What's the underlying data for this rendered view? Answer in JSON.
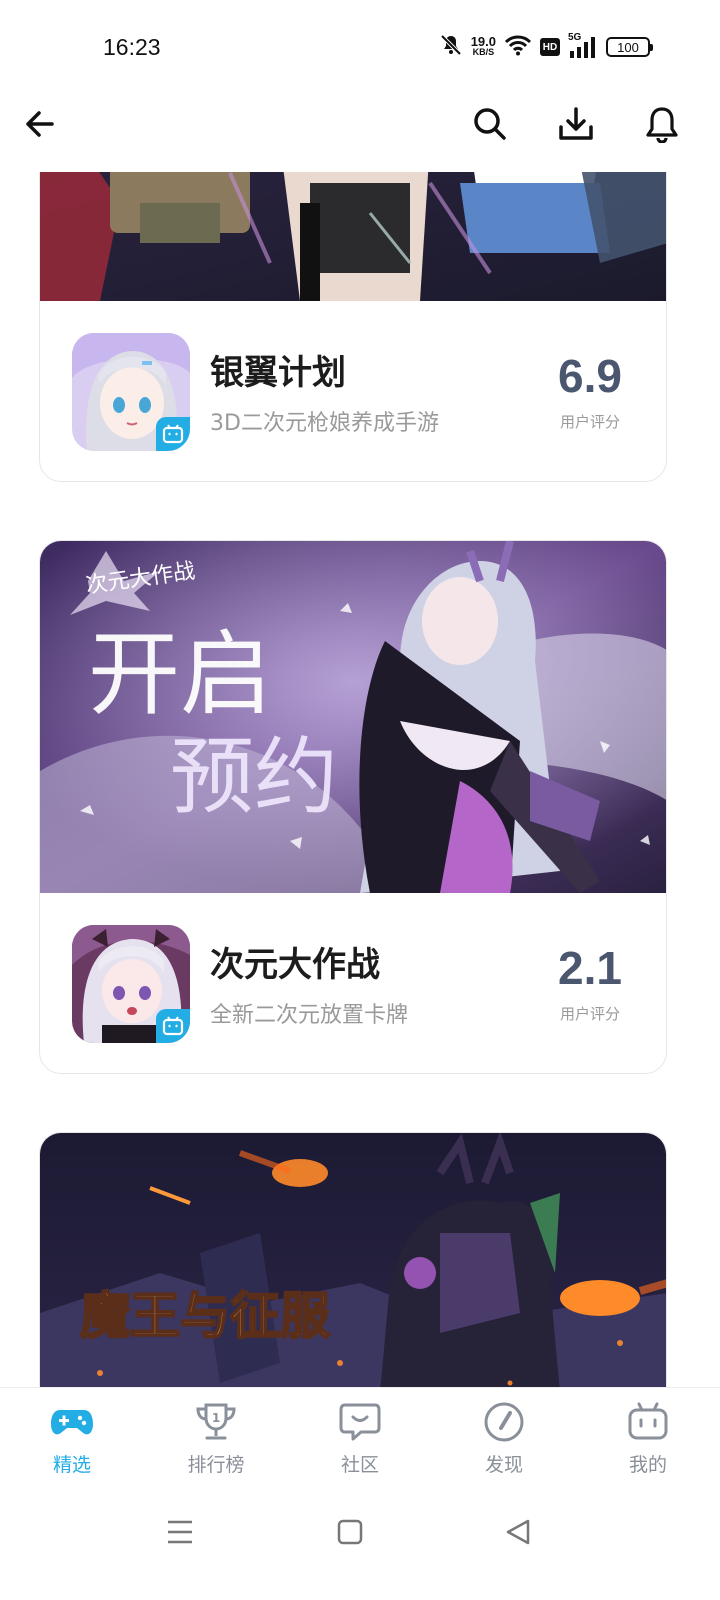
{
  "status_bar": {
    "time": "16:23",
    "net_speed_value": "19.0",
    "net_speed_unit": "KB/S",
    "hd_label": "HD",
    "network_type": "5G",
    "battery_level": "100",
    "icons": [
      "mute-bell-icon",
      "wifi-icon",
      "hd-icon",
      "signal-icon",
      "battery-icon"
    ]
  },
  "top_nav": {
    "icons": [
      "back-arrow-icon",
      "search-icon",
      "download-icon",
      "bell-icon"
    ]
  },
  "games": [
    {
      "title": "银翼计划",
      "subtitle": "3D二次元枪娘养成手游",
      "score": "6.9",
      "score_label": "用户评分"
    },
    {
      "title": "次元大作战",
      "subtitle": "全新二次元放置卡牌",
      "score": "2.1",
      "score_label": "用户评分",
      "banner_logo_text": "次元大作战",
      "banner_text_1": "开启",
      "banner_text_2": "预约"
    },
    {
      "banner_logo_text": "魔王与征服"
    }
  ],
  "tab_bar": {
    "active": "精选",
    "accent_color": "#23ade5",
    "tabs": [
      {
        "label": "精选",
        "icon": "gamepad-icon"
      },
      {
        "label": "排行榜",
        "icon": "trophy-icon"
      },
      {
        "label": "社区",
        "icon": "chat-bubble-icon"
      },
      {
        "label": "发现",
        "icon": "compass-icon"
      },
      {
        "label": "我的",
        "icon": "tv-face-icon"
      }
    ]
  },
  "system_nav": {
    "icons": [
      "menu-icon",
      "home-square-icon",
      "back-triangle-icon"
    ]
  }
}
